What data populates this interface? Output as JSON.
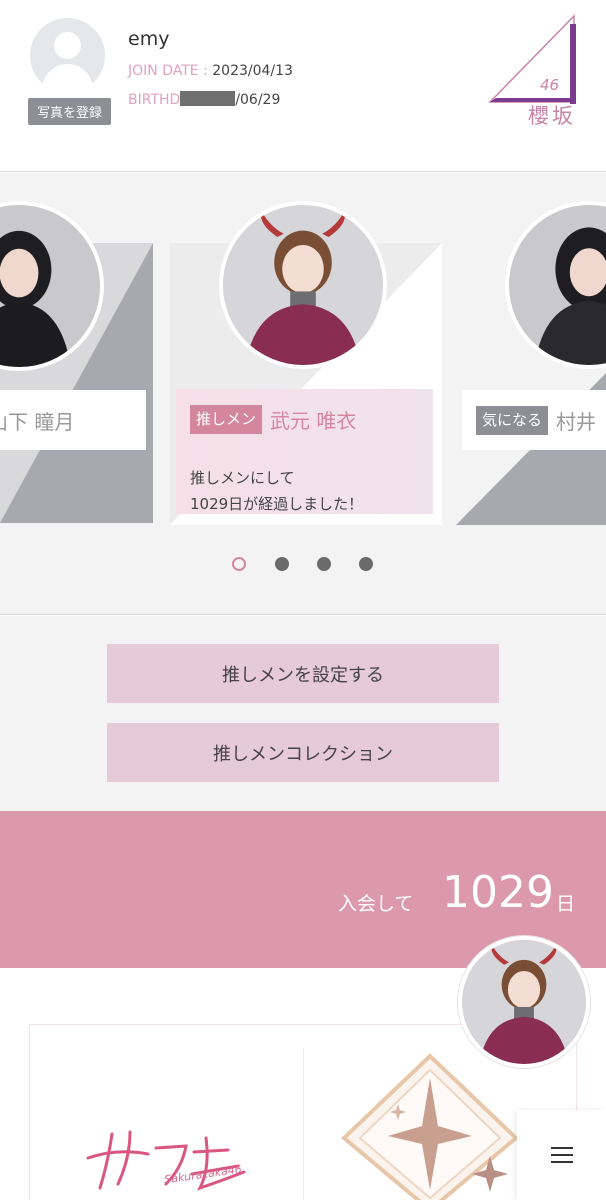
{
  "profile": {
    "username": "emy",
    "photo_button": "写真を登録",
    "join_label": "JOIN DATE : ",
    "join_value": "2023/04/13",
    "birth_label": "BIRTHD",
    "birth_value": "/06/29"
  },
  "logo": {
    "number": "46",
    "kanji": "櫻坂"
  },
  "carousel": {
    "left_member": {
      "name": "山下 瞳月"
    },
    "center_member": {
      "badge": "推しメン",
      "name": "武元 唯衣",
      "message": "推しメンにして\n1029日が経過しました！"
    },
    "right_member": {
      "badge": "気になる",
      "name": "村井"
    },
    "page_count": 4,
    "active_page": 1
  },
  "actions": {
    "set_button": "推しメンを設定する",
    "collection_button": "推しメンコレクション"
  },
  "join_banner": {
    "label": "入会して",
    "days": "1029",
    "unit": "日"
  },
  "bottom": {
    "sakukore_logo": "サクコレ",
    "sakukore_sub": "Sakurazaka46"
  },
  "icons": {
    "menu": "hamburger-menu-icon",
    "avatar": "default-avatar-icon"
  },
  "colors": {
    "accent_pink": "#dc98ad",
    "badge_pink": "#d4869f",
    "button_pink": "#e7cad7",
    "logo_purple": "#7b3c8f"
  }
}
